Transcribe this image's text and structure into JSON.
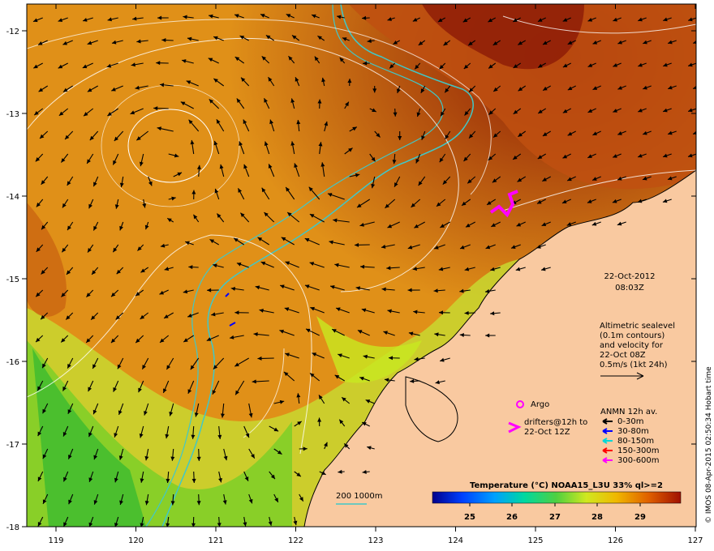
{
  "map": {
    "x_axis": {
      "ticks": [
        "119",
        "120",
        "121",
        "122",
        "123",
        "124",
        "125",
        "126",
        "127"
      ]
    },
    "y_axis": {
      "ticks": [
        "-12",
        "-13",
        "-14",
        "-15",
        "-16",
        "-17",
        "-18"
      ]
    }
  },
  "timestamp": {
    "date": "22-Oct-2012",
    "time": "08:03Z"
  },
  "altimetry_note": {
    "lines": [
      "Altimetric sealevel",
      "(0.1m contours)",
      "and velocity for",
      "22-Oct 08Z",
      "0.5m/s (1kt 24h)"
    ]
  },
  "legend": {
    "argo_label": "Argo",
    "drifters_lines": [
      "drifters@12h to",
      "22-Oct 12Z"
    ],
    "anmn_title": "ANMN 12h av.",
    "anmn_items": [
      {
        "label": "0-30m",
        "color": "#000000"
      },
      {
        "label": "30-80m",
        "color": "#0000ff"
      },
      {
        "label": "80-150m",
        "color": "#00d8d8"
      },
      {
        "label": "150-300m",
        "color": "#ff0000"
      },
      {
        "label": "300-600m",
        "color": "#ff00ff"
      }
    ],
    "argo_color": "#ff00ff",
    "drifter_color": "#ff00ff"
  },
  "isobath": {
    "label": "200  1000m",
    "color": "#40c8c8"
  },
  "colorbar": {
    "title": "Temperature (°C) NOAA15_L3U 33% ql>=2",
    "ticks": [
      "25",
      "26",
      "27",
      "28",
      "29"
    ]
  },
  "credit": "© IMOS 08-Apr-2015 02:50:34 Hobart time",
  "colors": {
    "land": "#f9c9a0",
    "warm": "#c86410",
    "hot": "#8c1a06",
    "cool": "#c8e820",
    "isobath": "#40c8c8"
  }
}
